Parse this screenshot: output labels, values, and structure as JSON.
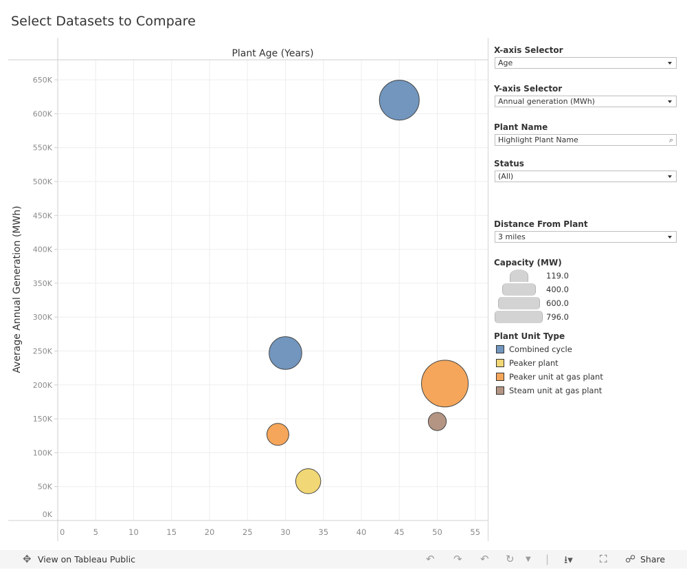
{
  "page": {
    "title": "Select Datasets to Compare"
  },
  "chart_data": {
    "type": "scatter",
    "subtype": "bubble",
    "title": "Plant Age (Years)",
    "xlabel": "Plant Age (Years)",
    "ylabel": "Average Annual Generation (MWh)",
    "xlim": [
      0,
      56.5
    ],
    "ylim": [
      0,
      680000
    ],
    "x_ticks": [
      0,
      5,
      10,
      15,
      20,
      25,
      30,
      35,
      40,
      45,
      50,
      55
    ],
    "x_tick_labels": [
      "0",
      "5",
      "10",
      "15",
      "20",
      "25",
      "30",
      "35",
      "40",
      "45",
      "50",
      "55"
    ],
    "y_ticks": [
      0,
      50000,
      100000,
      150000,
      200000,
      250000,
      300000,
      350000,
      400000,
      450000,
      500000,
      550000,
      600000,
      650000
    ],
    "y_tick_labels": [
      "0K",
      "50K",
      "100K",
      "150K",
      "200K",
      "250K",
      "300K",
      "350K",
      "400K",
      "450K",
      "500K",
      "550K",
      "600K",
      "650K"
    ],
    "grid": true,
    "size_field": "Capacity (MW)",
    "size_range": [
      119,
      796
    ],
    "color_field": "Plant Unit Type",
    "points": [
      {
        "x": 45,
        "y": 620000,
        "capacity": 580,
        "type": "Combined cycle"
      },
      {
        "x": 30,
        "y": 247000,
        "capacity": 390,
        "type": "Combined cycle"
      },
      {
        "x": 51,
        "y": 202000,
        "capacity": 796,
        "type": "Peaker unit at gas plant"
      },
      {
        "x": 50,
        "y": 146000,
        "capacity": 119,
        "type": "Steam unit at gas plant"
      },
      {
        "x": 29,
        "y": 127000,
        "capacity": 176,
        "type": "Peaker unit at gas plant"
      },
      {
        "x": 33,
        "y": 58000,
        "capacity": 229,
        "type": "Peaker plant"
      }
    ]
  },
  "filters": {
    "x_axis": {
      "label": "X-axis Selector",
      "value": "Age"
    },
    "y_axis": {
      "label": "Y-axis Selector",
      "value": "Annual generation (MWh)"
    },
    "plant_name": {
      "label": "Plant Name",
      "placeholder": "Highlight Plant Name",
      "icon": "search-icon"
    },
    "status": {
      "label": "Status",
      "value": "(All)"
    },
    "distance": {
      "label": "Distance From Plant",
      "value": "3 miles"
    }
  },
  "size_legend": {
    "title": "Capacity (MW)",
    "items": [
      {
        "value": 119,
        "label": "119.0"
      },
      {
        "value": 400,
        "label": "400.0"
      },
      {
        "value": 600,
        "label": "600.0"
      },
      {
        "value": 796,
        "label": "796.0"
      }
    ]
  },
  "color_legend": {
    "title": "Plant Unit Type",
    "items": [
      {
        "label": "Combined cycle",
        "color": "#7296be"
      },
      {
        "label": "Peaker plant",
        "color": "#f1d775"
      },
      {
        "label": "Peaker unit at gas plant",
        "color": "#f5a65b"
      },
      {
        "label": "Steam unit at gas plant",
        "color": "#b49583"
      }
    ]
  },
  "footer": {
    "view_link": "View on Tableau Public",
    "share_label": "Share",
    "icons": [
      "tableau-logo-icon",
      "undo-icon",
      "redo-icon",
      "revert-icon",
      "refresh-icon",
      "pause-dropdown-icon",
      "download-icon",
      "fullscreen-icon",
      "share-icon"
    ]
  }
}
